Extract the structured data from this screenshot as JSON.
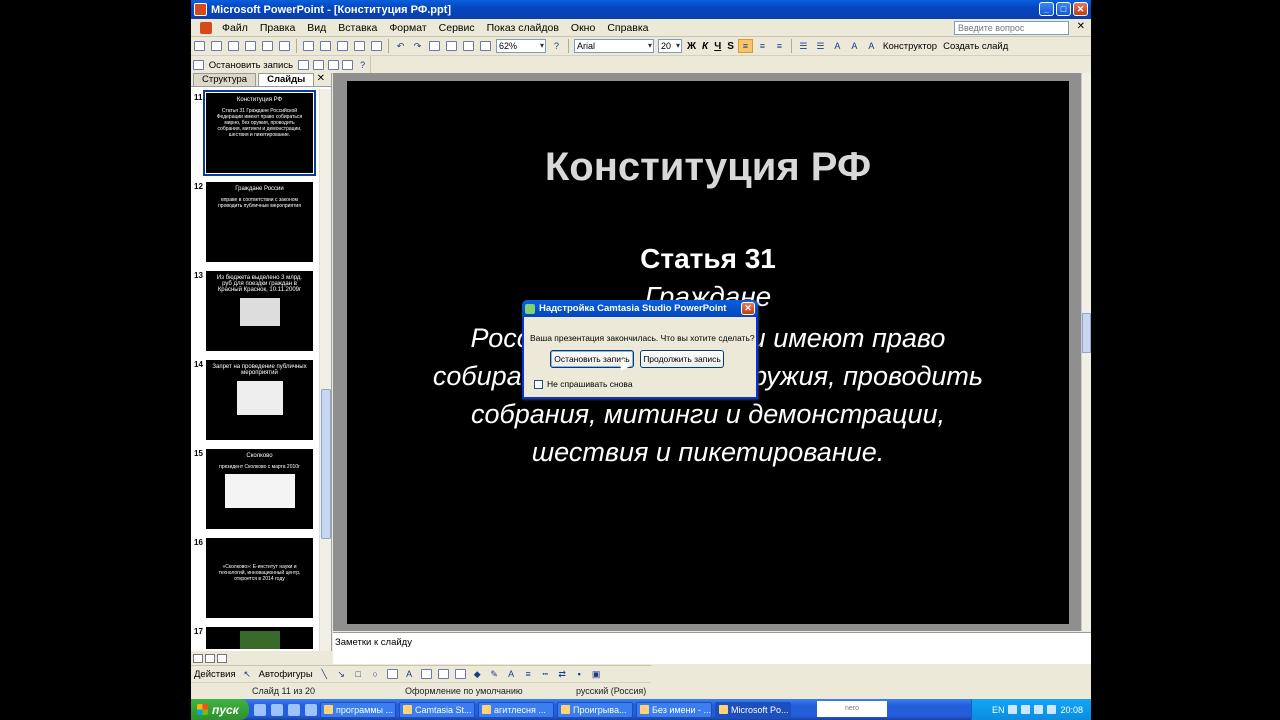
{
  "window": {
    "title": "Microsoft PowerPoint - [Конституция РФ.ppt]"
  },
  "menu": {
    "items": [
      "Файл",
      "Правка",
      "Вид",
      "Вставка",
      "Формат",
      "Сервис",
      "Показ слайдов",
      "Окно",
      "Справка"
    ],
    "ask_placeholder": "Введите вопрос"
  },
  "toolbar": {
    "zoom": "62%",
    "font": "Arial",
    "font_size": "20",
    "bold": "Ж",
    "italic": "К",
    "underline": "Ч",
    "shadow": "S",
    "designer": "Конструктор",
    "create_slide": "Создать слайд"
  },
  "record_toolbar": {
    "stop_label": "Остановить запись"
  },
  "left_pane": {
    "tab_outline": "Структура",
    "tab_slides": "Слайды",
    "slides": [
      {
        "num": "11",
        "title": "Конституция РФ",
        "text": "Статья 31 Граждане Российской Федерации имеют право собираться мирно, без оружия, проводить собрания, митинги и демонстрации, шествия и пикетирование."
      },
      {
        "num": "12",
        "title": "Граждане России",
        "text": "вправе в соответствии с законом проводить публичные мероприятия"
      },
      {
        "num": "13",
        "title": "Из бюджета выделено 3 млрд. руб для поездки граждан в Красный Краснок, 10.11.2009г",
        "text": ""
      },
      {
        "num": "14",
        "title": "Запрет на проведение публичных мероприятий",
        "text": ""
      },
      {
        "num": "15",
        "title": "Сколково",
        "text": "президент Сколково с марта 2010г"
      },
      {
        "num": "16",
        "title": "",
        "text": "«Сколково»: Е-институт науки и технологий, инновационный центр, откроется в 2014 году"
      },
      {
        "num": "17",
        "title": "",
        "text": ""
      }
    ]
  },
  "slide": {
    "title": "Конституция РФ",
    "article": "Статья 31",
    "citizens": "Граждане",
    "body": "Российской Федерации имеют право собираться мирно, без оружия, проводить собрания, митинги и демонстрации, шествия и пикетирование."
  },
  "notes": {
    "placeholder": "Заметки к слайду"
  },
  "draw_toolbar": {
    "actions": "Действия",
    "autoshapes": "Автофигуры"
  },
  "status": {
    "slide": "Слайд 11 из 20",
    "design": "Оформление по умолчанию",
    "language": "русский (Россия)"
  },
  "dialog": {
    "title": "Надстройка Camtasia Studio PowerPoint",
    "message": "Ваша презентация закончилась. Что вы хотите сделать?",
    "stop_button": "Остановить запись",
    "continue_button": "Продолжить запись",
    "dont_ask": "Не спрашивать снова"
  },
  "taskbar": {
    "start": "пуск",
    "tasks": [
      "программы ...",
      "Camtasia St...",
      "агитлесня ...",
      "Проигрыва...",
      "Без имени - ...",
      "Microsoft Po..."
    ],
    "lang": "EN",
    "time": "20:08",
    "nero": "nero"
  }
}
